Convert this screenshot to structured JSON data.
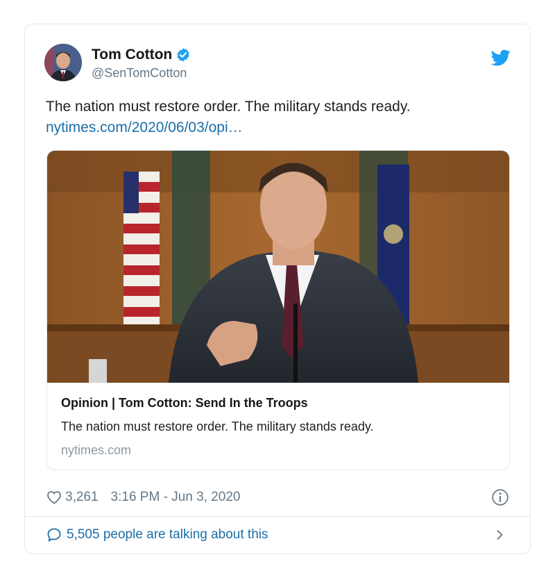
{
  "author": {
    "name": "Tom Cotton",
    "handle": "@SenTomCotton",
    "verified": true
  },
  "tweet": {
    "text": "The nation must restore order. The military stands ready.",
    "link": "nytimes.com/2020/06/03/opi…"
  },
  "card": {
    "title": "Opinion | Tom Cotton: Send In the Troops",
    "description": "The nation must restore order. The military stands ready.",
    "domain": "nytimes.com"
  },
  "meta": {
    "likes": "3,261",
    "timestamp": "3:16 PM - Jun 3, 2020"
  },
  "footer": {
    "conversation": "5,505 people are talking about this"
  },
  "icons": {
    "bird": "twitter-bird-icon",
    "verified": "verified-badge-icon",
    "heart": "heart-icon",
    "info": "info-icon",
    "bubble": "speech-bubble-icon",
    "chevron": "chevron-right-icon"
  },
  "colors": {
    "twitter_blue": "#1da1f2",
    "link": "#1b6ea8",
    "muted": "#657786"
  }
}
